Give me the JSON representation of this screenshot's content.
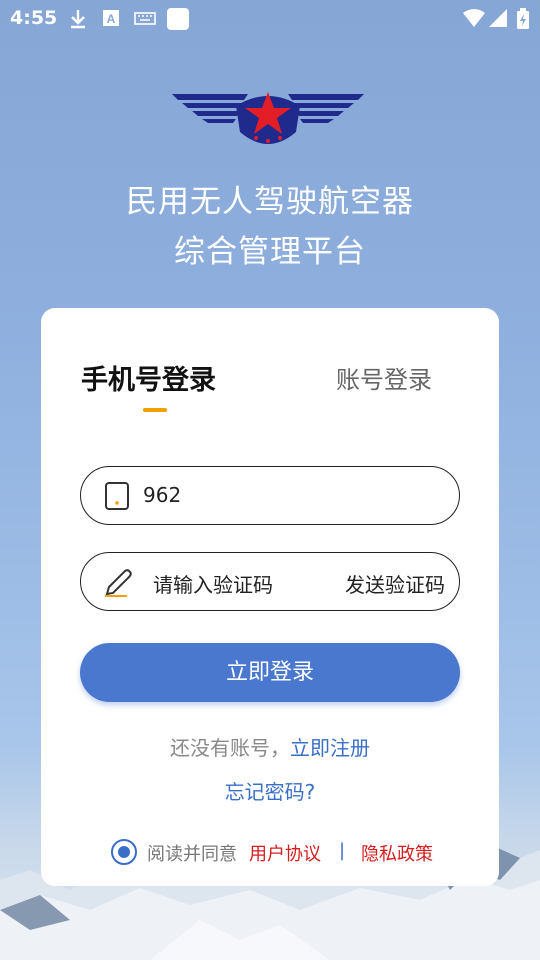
{
  "status_bar": {
    "time": "4:55"
  },
  "app": {
    "title_line1": "民用无人驾驶航空器",
    "title_line2": "综合管理平台"
  },
  "tabs": {
    "phone_login": "手机号登录",
    "account_login": "账号登录"
  },
  "form": {
    "phone_value": "962",
    "code_placeholder": "请输入验证码",
    "send_code_label": "发送验证码",
    "login_label": "立即登录"
  },
  "links": {
    "no_account_prompt": "还没有账号，",
    "register_label": "立即注册",
    "forgot_password": "忘记密码?"
  },
  "agreement": {
    "checked": true,
    "prefix": "阅读并同意",
    "user_agreement": "用户协议",
    "separator": "|",
    "privacy_policy": "隐私政策"
  },
  "colors": {
    "primary": "#4a78cf",
    "accent": "#f2a000",
    "link": "#3a6fc7",
    "danger": "#d61e1e"
  }
}
